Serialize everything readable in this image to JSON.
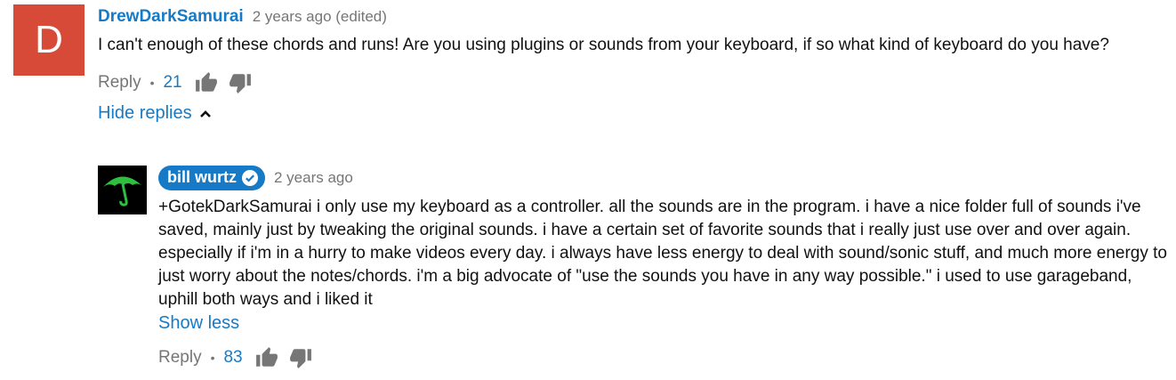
{
  "comment": {
    "avatar_letter": "D",
    "avatar_color": "#d84a38",
    "author": "DrewDarkSamurai",
    "timestamp": "2 years ago (edited)",
    "text": "I can't enough of these chords and runs! Are you using plugins or sounds from your keyboard, if so what kind of keyboard do you have?",
    "reply_label": "Reply",
    "separator": "•",
    "likes": "21",
    "like_icon": "thumb-up-icon",
    "dislike_icon": "thumb-down-icon",
    "hide_replies_label": "Hide replies"
  },
  "reply": {
    "avatar_icon": "green-umbrella-icon",
    "author": "bill wurtz",
    "verified_icon": "check-circle-icon",
    "timestamp": "2 years ago",
    "text": "+GotekDarkSamurai i only use my keyboard as a controller. all the sounds are in the program. i have a nice folder full of sounds i've saved, mainly just by tweaking the original sounds. i have a certain set of favorite sounds that i really just use over and over again. especially if i'm in a hurry to make videos every day. i always have less energy to deal with sound/sonic stuff, and much more energy to just worry about the notes/chords. i'm a big advocate of \"use the sounds you have in any way possible.\" i used to use garageband, uphill both ways and i liked it",
    "show_less_label": "Show less",
    "reply_label": "Reply",
    "separator": "•",
    "likes": "83"
  },
  "colors": {
    "link_blue": "#167ac6",
    "meta_gray": "#767676",
    "avatar_red": "#d84a38",
    "umbrella_green": "#2fbf3f"
  }
}
